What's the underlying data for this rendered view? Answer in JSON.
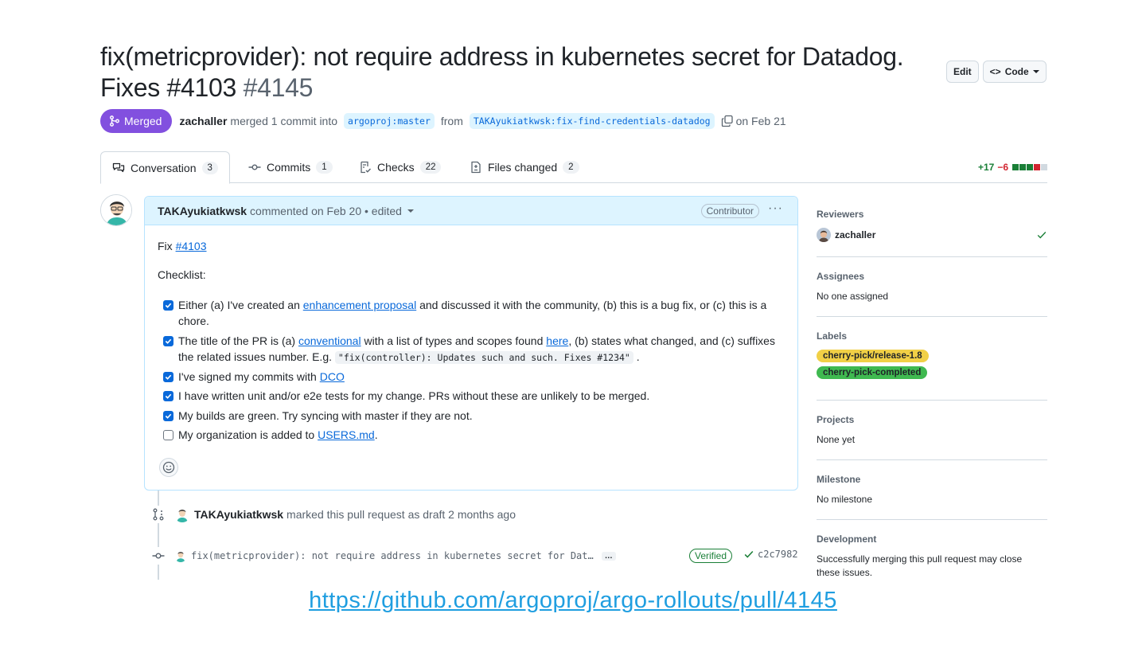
{
  "header": {
    "title": "fix(metricprovider): not require address in kubernetes secret for Datadog. Fixes #4103",
    "number": "#4145",
    "edit_label": "Edit",
    "code_label": "Code"
  },
  "meta": {
    "status": "Merged",
    "user": "zachaller",
    "action": "merged 1 commit into",
    "base_branch": "argoproj:master",
    "from_text": "from",
    "head_branch": "TAKAyukiatkwsk:fix-find-credentials-datadog",
    "date_text": "on Feb 21"
  },
  "tabs": [
    {
      "label": "Conversation",
      "count": "3"
    },
    {
      "label": "Commits",
      "count": "1"
    },
    {
      "label": "Checks",
      "count": "22"
    },
    {
      "label": "Files changed",
      "count": "2"
    }
  ],
  "diffstat": {
    "additions": "+17",
    "deletions": "−6",
    "colors": [
      "#1a7f37",
      "#1a7f37",
      "#1a7f37",
      "#d1242f",
      "#d1d9e0"
    ]
  },
  "comment": {
    "author": "TAKAyukiatkwsk",
    "action": "commented on Feb 20 • edited",
    "role_badge": "Contributor",
    "fix_prefix": "Fix",
    "fix_link": "#4103",
    "checklist_label": "Checklist:",
    "tasks": [
      {
        "checked": true,
        "parts": [
          "Either (a) I've created an ",
          "enhancement proposal",
          " and discussed it with the community, (b) this is a bug fix, or (c) this is a chore."
        ]
      },
      {
        "checked": true,
        "parts": [
          "The title of the PR is (a) ",
          "conventional",
          " with a list of types and scopes found ",
          "here",
          ", (b) states what changed, and (c) suffixes the related issues number. E.g. ",
          "\"fix(controller): Updates such and such. Fixes #1234\"",
          " ."
        ]
      },
      {
        "checked": true,
        "parts": [
          "I've signed my commits with ",
          "DCO"
        ]
      },
      {
        "checked": true,
        "parts": [
          "I have written unit and/or e2e tests for my change. PRs without these are unlikely to be merged."
        ]
      },
      {
        "checked": true,
        "parts": [
          "My builds are green. Try syncing with master if they are not."
        ]
      },
      {
        "checked": false,
        "parts": [
          "My organization is added to ",
          "USERS.md",
          "."
        ]
      }
    ]
  },
  "timeline": {
    "draft_user": "TAKAyukiatkwsk",
    "draft_text": "marked this pull request as draft 2 months ago",
    "commit_message": "fix(metricprovider): not require address in kubernetes secret for Dat…",
    "commit_more": "…",
    "verified": "Verified",
    "sha": "c2c7982"
  },
  "sidebar": {
    "reviewers_head": "Reviewers",
    "reviewer": "zachaller",
    "assignees_head": "Assignees",
    "assignees_text": "No one assigned",
    "labels_head": "Labels",
    "labels": [
      {
        "name": "cherry-pick/release-1.8",
        "color": "#f1d046"
      },
      {
        "name": "cherry-pick-completed",
        "color": "#3fb950"
      }
    ],
    "projects_head": "Projects",
    "projects_text": "None yet",
    "milestone_head": "Milestone",
    "milestone_text": "No milestone",
    "development_head": "Development",
    "development_text": "Successfully merging this pull request may close these issues."
  },
  "footer": {
    "url": "https://github.com/argoproj/argo-rollouts/pull/4145"
  }
}
